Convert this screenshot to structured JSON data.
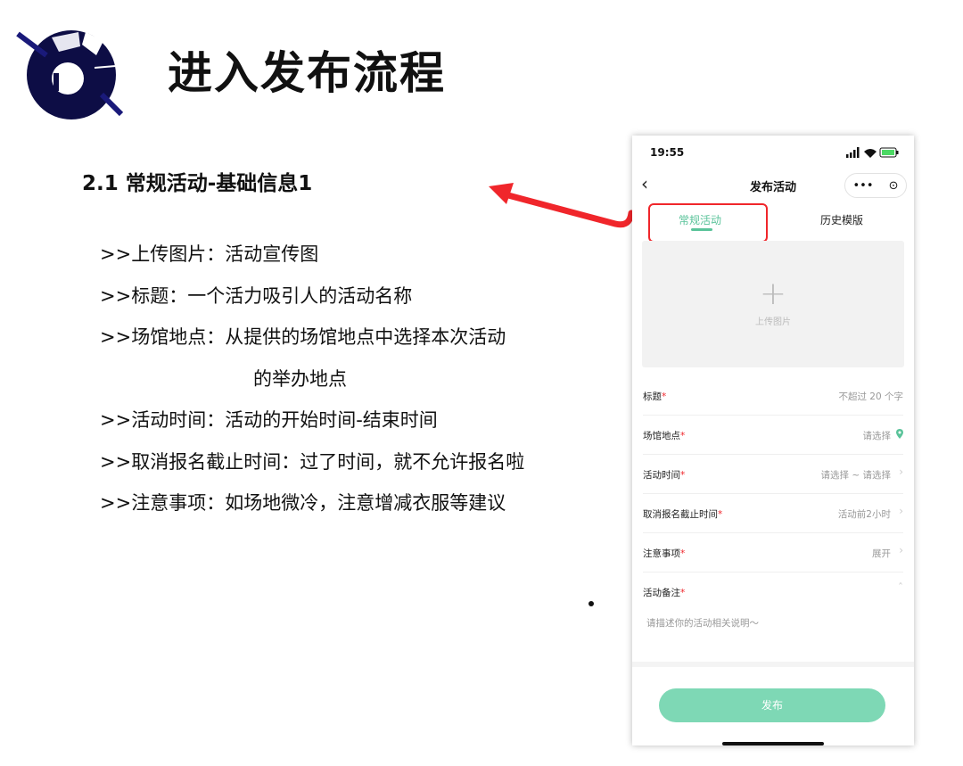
{
  "slide": {
    "title": "进入发布流程",
    "section_title": "2.1  常规活动-基础信息1",
    "bullets": [
      ">>上传图片：活动宣传图",
      ">>标题：一个活力吸引人的活动名称",
      ">>场馆地点：从提供的场馆地点中选择本次活动",
      "的举办地点",
      ">>活动时间：活动的开始时间-结束时间",
      ">>取消报名截止时间：过了时间，就不允许报名啦",
      ">>注意事项：如场地微冷，注意增减衣服等建议"
    ]
  },
  "phone": {
    "status_time": "19:55",
    "nav_title": "发布活动",
    "capsule_more": "•••",
    "capsule_close": "⊙",
    "back_icon": "‹",
    "tabs": [
      "常规活动",
      "历史模版"
    ],
    "upload_plus": "+",
    "upload_label": "上传图片",
    "rows": [
      {
        "label": "标题",
        "req": "*",
        "value": "不超过 20 个字"
      },
      {
        "label": "场馆地点",
        "req": "*",
        "value": "请选择"
      },
      {
        "label": "活动时间",
        "req": "*",
        "value": "请选择 ~ 请选择",
        "chev": "›"
      },
      {
        "label": "取消报名截止时间",
        "req": "*",
        "value": "活动前2小时",
        "chev": "›"
      },
      {
        "label": "注意事项",
        "req": "*",
        "value": "展开",
        "chev": "›"
      }
    ],
    "remarks": {
      "label": "活动备注",
      "req": "*",
      "placeholder": "请描述你的活动相关说明～",
      "chev": "ˆ"
    },
    "publish_label": "发布"
  },
  "colors": {
    "accent": "#5ac39a",
    "publish_button": "#7ed8b5",
    "highlight": "#f0262b",
    "logo_navy": "#0d0d45"
  }
}
